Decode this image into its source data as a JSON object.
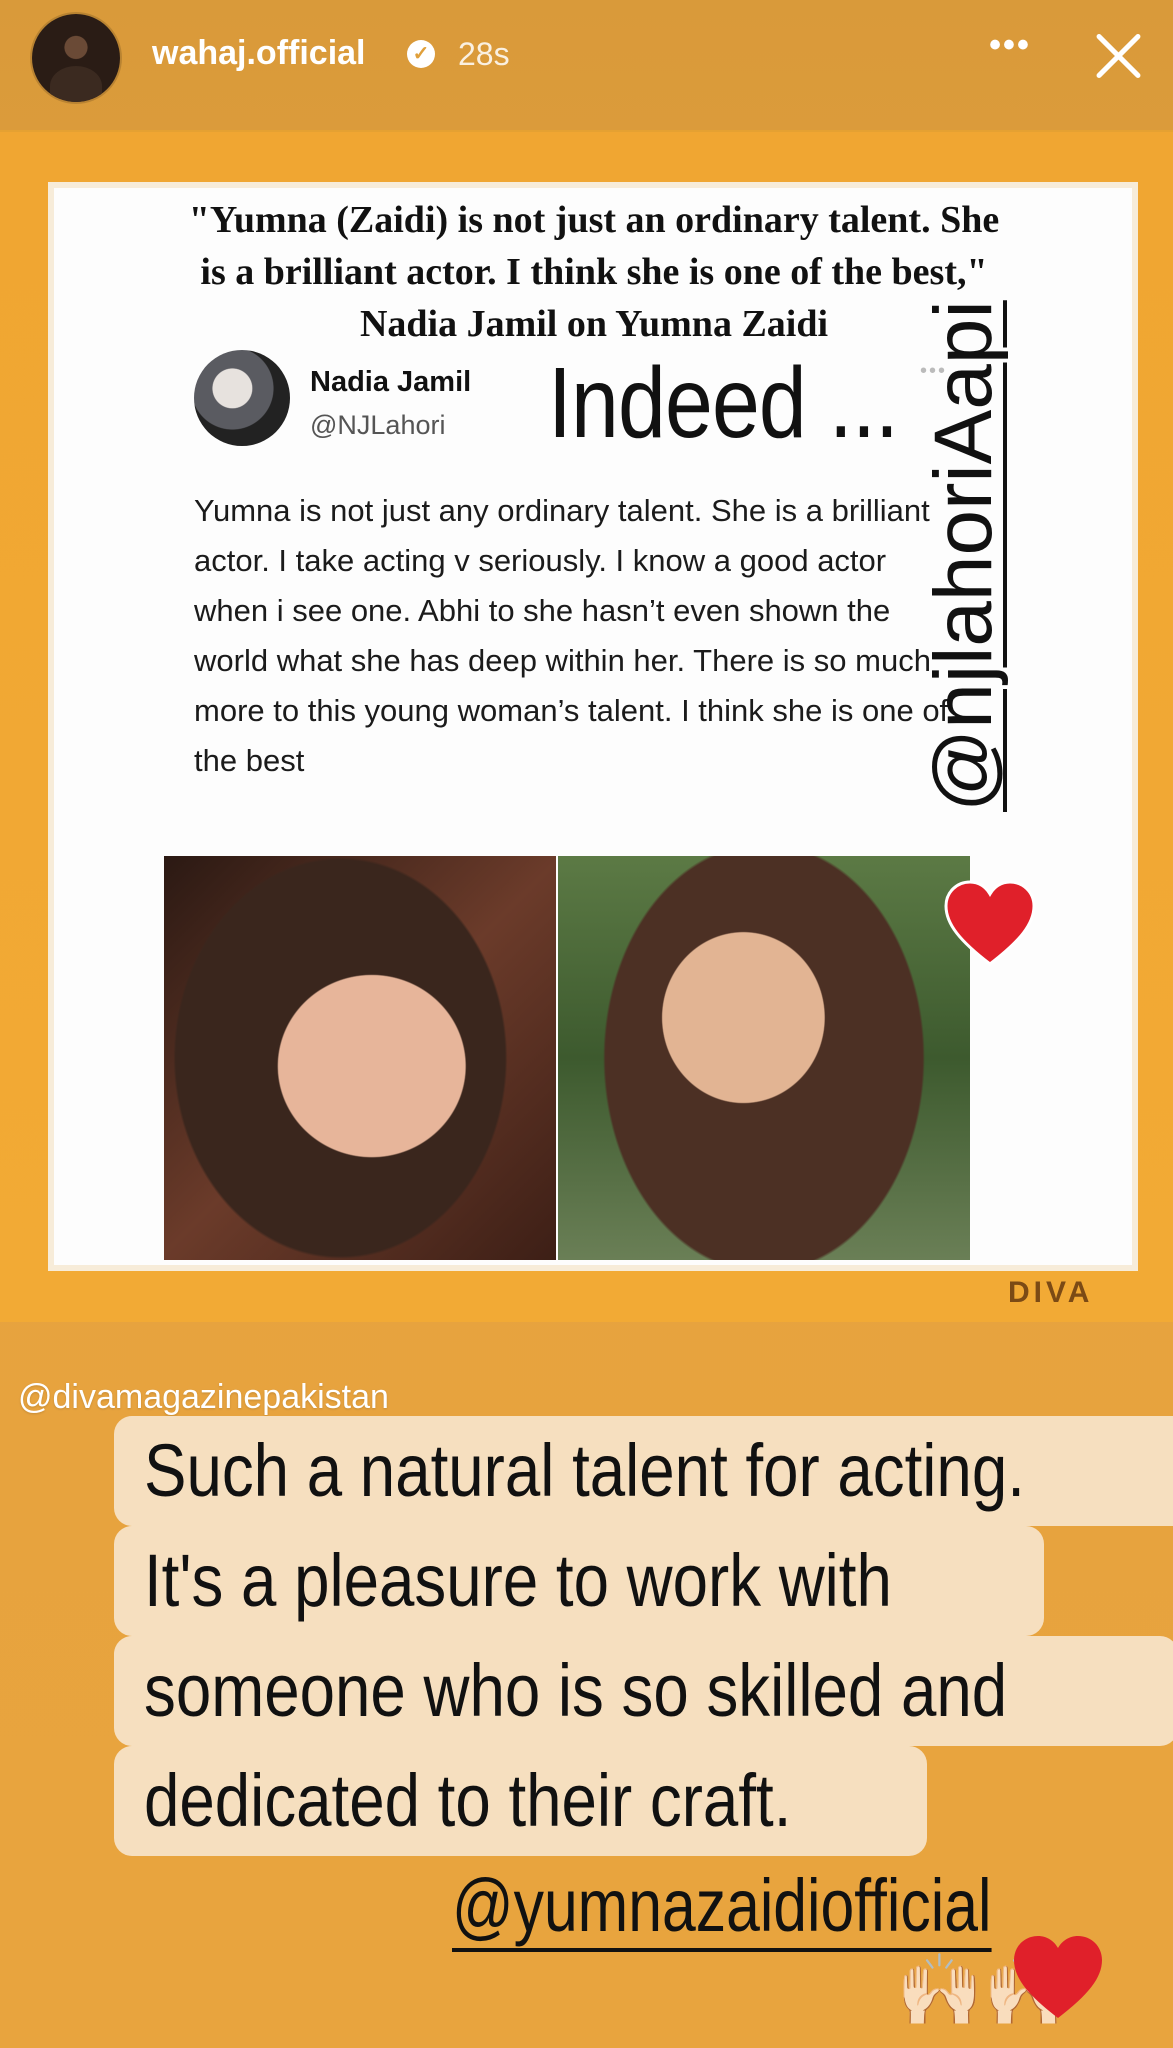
{
  "header": {
    "username": "wahaj.official",
    "time": "28s",
    "verified_icon": "verified-badge-icon",
    "more_icon": "more-options-icon",
    "close_icon": "close-icon"
  },
  "post": {
    "headline_line1": "\"Yumna (Zaidi) is not just an ordinary talent. She",
    "headline_line2": "is a brilliant actor. I think she is one of the best,\"",
    "headline_sub": "Nadia Jamil on Yumna Zaidi",
    "tweet_name": "Nadia Jamil",
    "tweet_handle": "@NJLahori",
    "tweet_text": "Yumna is not just any ordinary talent. She is a brilliant actor. I take acting v seriously. I know a good actor when i see one. Abhi to she hasn’t even shown the world what she has deep within her. There is so much more to this young woman’s talent. I think she is one of the best",
    "sticker_indeed": "Indeed ...",
    "sticker_mention": "@njlahoriAapi",
    "brand": "DIVA"
  },
  "caption": {
    "credit": "@divamagazinepakistan",
    "lines": [
      "Such a natural talent for acting.",
      "It's a pleasure to work with",
      "someone who is so skilled and",
      "dedicated to their craft."
    ],
    "mention": "@yumnazaidiofficial",
    "emoji_hands": "🙌🏻🙌🏻"
  },
  "colors": {
    "background": "#e3a03c",
    "caption_highlight": "#f6dfbf",
    "heart": "#e0202a"
  }
}
